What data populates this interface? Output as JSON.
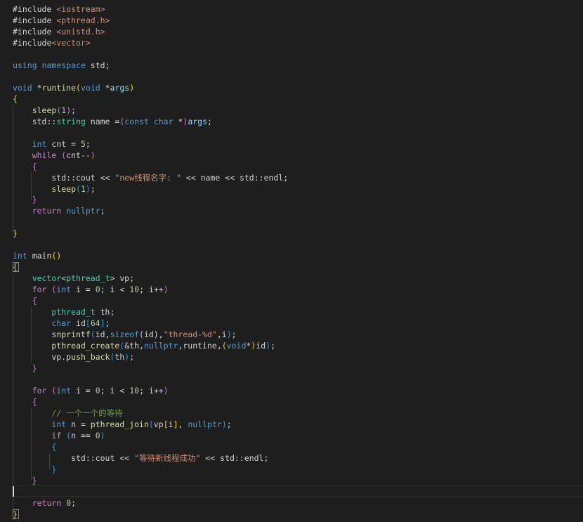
{
  "colors": {
    "background": "#1e1e1e",
    "plain": "#d4d4d4",
    "keyword": "#569cd6",
    "control": "#c586c0",
    "string": "#ce9178",
    "number": "#b5cea8",
    "function": "#dcdcaa",
    "type": "#4ec9b0",
    "variable": "#9cdcfe",
    "comment": "#6a9955",
    "bracket_gold": "#ffd700",
    "bracket_pink": "#da70d6",
    "bracket_blue": "#179fff",
    "preprocessor": "#c586c0"
  },
  "code_lines": [
    [
      [
        "#include ",
        "plain"
      ],
      [
        "<iostream>",
        "string"
      ]
    ],
    [
      [
        "#include ",
        "plain"
      ],
      [
        "<pthread.h>",
        "string"
      ]
    ],
    [
      [
        "#include ",
        "plain"
      ],
      [
        "<unistd.h>",
        "string"
      ]
    ],
    [
      [
        "#include",
        "plain"
      ],
      [
        "<vector>",
        "string"
      ]
    ],
    [],
    [
      [
        "using",
        "keyword"
      ],
      [
        " ",
        "plain"
      ],
      [
        "namespace",
        "keyword"
      ],
      [
        " std;",
        "plain"
      ]
    ],
    [],
    [
      [
        "void",
        "keyword"
      ],
      [
        " *",
        "plain"
      ],
      [
        "runtine",
        "function"
      ],
      [
        "(",
        "bracket_gold"
      ],
      [
        "void",
        "keyword"
      ],
      [
        " *",
        "plain"
      ],
      [
        "args",
        "variable"
      ],
      [
        ")",
        "bracket_gold"
      ]
    ],
    [
      [
        "{",
        "bracket_gold"
      ]
    ],
    [
      [
        "    ",
        "plain"
      ],
      [
        "sleep",
        "function"
      ],
      [
        "(",
        "bracket_pink"
      ],
      [
        "1",
        "number"
      ],
      [
        ")",
        "bracket_pink"
      ],
      [
        ";",
        "plain"
      ]
    ],
    [
      [
        "    std::",
        "plain"
      ],
      [
        "string",
        "type"
      ],
      [
        " name =",
        "plain"
      ],
      [
        "(",
        "bracket_pink"
      ],
      [
        "const",
        "keyword"
      ],
      [
        " ",
        "plain"
      ],
      [
        "char",
        "keyword"
      ],
      [
        " *",
        "plain"
      ],
      [
        ")",
        "bracket_pink"
      ],
      [
        "args",
        "variable"
      ],
      [
        ";",
        "plain"
      ]
    ],
    [],
    [
      [
        "    ",
        "plain"
      ],
      [
        "int",
        "keyword"
      ],
      [
        " cnt = ",
        "plain"
      ],
      [
        "5",
        "number"
      ],
      [
        ";",
        "plain"
      ]
    ],
    [
      [
        "    ",
        "plain"
      ],
      [
        "while",
        "control"
      ],
      [
        " ",
        "plain"
      ],
      [
        "(",
        "bracket_pink"
      ],
      [
        "cnt--",
        "plain"
      ],
      [
        ")",
        "bracket_pink"
      ]
    ],
    [
      [
        "    ",
        "plain"
      ],
      [
        "{",
        "bracket_pink"
      ]
    ],
    [
      [
        "        std::cout << ",
        "plain"
      ],
      [
        "\"new线程名字: \"",
        "string"
      ],
      [
        " << name << std::endl;",
        "plain"
      ]
    ],
    [
      [
        "        ",
        "plain"
      ],
      [
        "sleep",
        "function"
      ],
      [
        "(",
        "bracket_blue"
      ],
      [
        "1",
        "number"
      ],
      [
        ")",
        "bracket_blue"
      ],
      [
        ";",
        "plain"
      ]
    ],
    [
      [
        "    ",
        "plain"
      ],
      [
        "}",
        "bracket_pink"
      ]
    ],
    [
      [
        "    ",
        "plain"
      ],
      [
        "return",
        "control"
      ],
      [
        " ",
        "plain"
      ],
      [
        "nullptr",
        "keyword"
      ],
      [
        ";",
        "plain"
      ]
    ],
    [],
    [
      [
        "}",
        "bracket_gold"
      ]
    ],
    [],
    [
      [
        "int",
        "keyword"
      ],
      [
        " main",
        "plain"
      ],
      [
        "()",
        "bracket_gold"
      ]
    ],
    [
      [
        "{",
        "bracket_gold"
      ]
    ],
    [
      [
        "    ",
        "plain"
      ],
      [
        "vector",
        "type"
      ],
      [
        "<",
        "plain"
      ],
      [
        "pthread_t",
        "type"
      ],
      [
        "> vp;",
        "plain"
      ]
    ],
    [
      [
        "    ",
        "plain"
      ],
      [
        "for",
        "control"
      ],
      [
        " ",
        "plain"
      ],
      [
        "(",
        "bracket_pink"
      ],
      [
        "int",
        "keyword"
      ],
      [
        " i = ",
        "plain"
      ],
      [
        "0",
        "number"
      ],
      [
        "; i < ",
        "plain"
      ],
      [
        "10",
        "number"
      ],
      [
        "; i++",
        "plain"
      ],
      [
        ")",
        "bracket_pink"
      ]
    ],
    [
      [
        "    ",
        "plain"
      ],
      [
        "{",
        "bracket_pink"
      ]
    ],
    [
      [
        "        ",
        "plain"
      ],
      [
        "pthread_t",
        "type"
      ],
      [
        " th;",
        "plain"
      ]
    ],
    [
      [
        "        ",
        "plain"
      ],
      [
        "char",
        "keyword"
      ],
      [
        " id",
        "plain"
      ],
      [
        "[",
        "bracket_blue"
      ],
      [
        "64",
        "number"
      ],
      [
        "]",
        "bracket_blue"
      ],
      [
        ";",
        "plain"
      ]
    ],
    [
      [
        "        ",
        "plain"
      ],
      [
        "snprintf",
        "function"
      ],
      [
        "(",
        "bracket_blue"
      ],
      [
        "id,",
        "plain"
      ],
      [
        "sizeof",
        "keyword"
      ],
      [
        "(id),",
        "plain"
      ],
      [
        "\"thread-%d\"",
        "string"
      ],
      [
        ",i",
        "plain"
      ],
      [
        ")",
        "bracket_blue"
      ],
      [
        ";",
        "plain"
      ]
    ],
    [
      [
        "        ",
        "plain"
      ],
      [
        "pthread_create",
        "function"
      ],
      [
        "(",
        "bracket_blue"
      ],
      [
        "&th,",
        "plain"
      ],
      [
        "nullptr",
        "keyword"
      ],
      [
        ",runtine,",
        "plain"
      ],
      [
        "(",
        "bracket_gold"
      ],
      [
        "void",
        "keyword"
      ],
      [
        "*",
        "plain"
      ],
      [
        ")",
        "bracket_gold"
      ],
      [
        "id",
        "plain"
      ],
      [
        ")",
        "bracket_blue"
      ],
      [
        ";",
        "plain"
      ]
    ],
    [
      [
        "        vp.",
        "plain"
      ],
      [
        "push_back",
        "function"
      ],
      [
        "(",
        "bracket_blue"
      ],
      [
        "th",
        "plain"
      ],
      [
        ")",
        "bracket_blue"
      ],
      [
        ";",
        "plain"
      ]
    ],
    [
      [
        "    ",
        "plain"
      ],
      [
        "}",
        "bracket_pink"
      ]
    ],
    [],
    [
      [
        "    ",
        "plain"
      ],
      [
        "for",
        "control"
      ],
      [
        " ",
        "plain"
      ],
      [
        "(",
        "bracket_pink"
      ],
      [
        "int",
        "keyword"
      ],
      [
        " i = ",
        "plain"
      ],
      [
        "0",
        "number"
      ],
      [
        "; i < ",
        "plain"
      ],
      [
        "10",
        "number"
      ],
      [
        "; i++",
        "plain"
      ],
      [
        ")",
        "bracket_pink"
      ]
    ],
    [
      [
        "    ",
        "plain"
      ],
      [
        "{",
        "bracket_pink"
      ]
    ],
    [
      [
        "        ",
        "plain"
      ],
      [
        "// 一个一个的等待",
        "comment"
      ]
    ],
    [
      [
        "        ",
        "plain"
      ],
      [
        "int",
        "keyword"
      ],
      [
        " n = ",
        "plain"
      ],
      [
        "pthread_join",
        "function"
      ],
      [
        "(",
        "bracket_blue"
      ],
      [
        "vp",
        "plain"
      ],
      [
        "[",
        "bracket_gold"
      ],
      [
        "i",
        "plain"
      ],
      [
        "]",
        "bracket_gold"
      ],
      [
        ", ",
        "plain"
      ],
      [
        "nullptr",
        "keyword"
      ],
      [
        ")",
        "bracket_blue"
      ],
      [
        ";",
        "plain"
      ]
    ],
    [
      [
        "        ",
        "plain"
      ],
      [
        "if",
        "control"
      ],
      [
        " ",
        "plain"
      ],
      [
        "(",
        "bracket_blue"
      ],
      [
        "n == ",
        "plain"
      ],
      [
        "0",
        "number"
      ],
      [
        ")",
        "bracket_blue"
      ]
    ],
    [
      [
        "        ",
        "plain"
      ],
      [
        "{",
        "bracket_blue"
      ]
    ],
    [
      [
        "            std::cout << ",
        "plain"
      ],
      [
        "\"等待新线程成功\"",
        "string"
      ],
      [
        " << std::endl;",
        "plain"
      ]
    ],
    [
      [
        "        ",
        "plain"
      ],
      [
        "}",
        "bracket_blue"
      ]
    ],
    [
      [
        "    ",
        "plain"
      ],
      [
        "}",
        "bracket_pink"
      ]
    ],
    [],
    [
      [
        "    ",
        "plain"
      ],
      [
        "return",
        "control"
      ],
      [
        " ",
        "plain"
      ],
      [
        "0",
        "number"
      ],
      [
        ";",
        "plain"
      ]
    ],
    [
      [
        "}",
        "bracket_gold"
      ]
    ]
  ]
}
